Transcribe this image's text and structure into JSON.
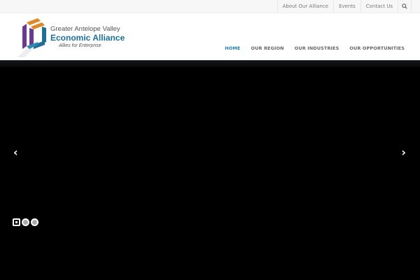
{
  "topbar": {
    "links": [
      "About Our Alliance",
      "Events",
      "Contact Us"
    ],
    "search_icon": "search-icon"
  },
  "logo": {
    "line1": "Greater Antelope Valley",
    "line2": "Economic Alliance",
    "tagline": "Allies for Enterprise"
  },
  "nav": {
    "items": [
      "HOME",
      "OUR REGION",
      "OUR INDUSTRIES",
      "OUR OPPORTUNITIES"
    ],
    "active": "HOME"
  },
  "slider": {
    "prev_icon": "chevron-left-icon",
    "next_icon": "chevron-right-icon",
    "slides": 3,
    "active_slide": 1
  },
  "colors": {
    "accent": "#1e7db5",
    "logo_blue": "#1e6f98",
    "orange": "#e0892a",
    "purple": "#6a3a8c"
  }
}
